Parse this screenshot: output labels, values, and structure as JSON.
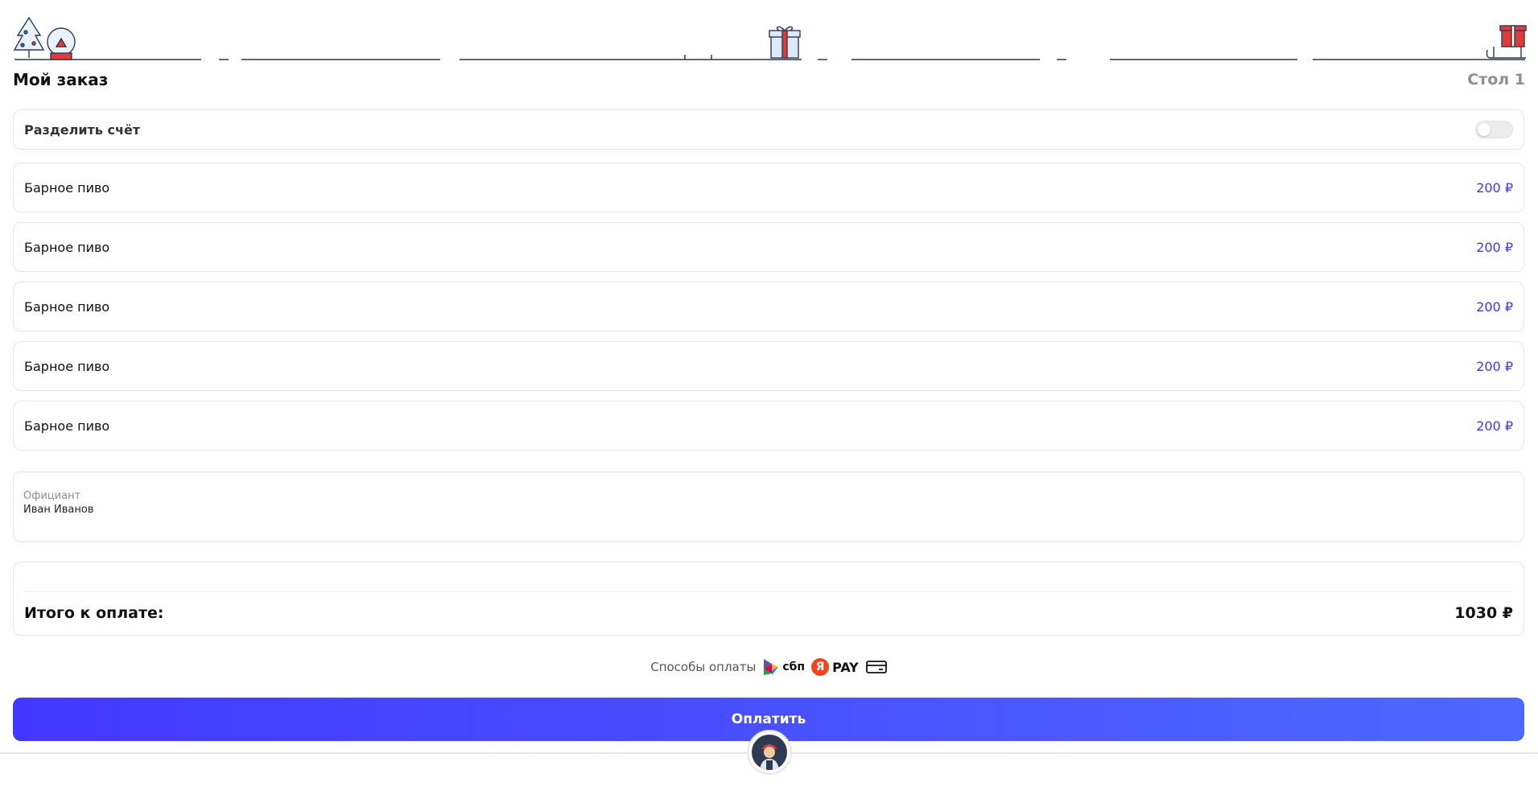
{
  "header": {
    "title": "Мой заказ",
    "table": "Стол 1"
  },
  "split": {
    "label": "Разделить счёт",
    "enabled": false
  },
  "items": [
    {
      "name": "Барное пиво",
      "price": "200 ₽"
    },
    {
      "name": "Барное пиво",
      "price": "200 ₽"
    },
    {
      "name": "Барное пиво",
      "price": "200 ₽"
    },
    {
      "name": "Барное пиво",
      "price": "200 ₽"
    },
    {
      "name": "Барное пиво",
      "price": "200 ₽"
    }
  ],
  "waiter": {
    "label": "Официант",
    "name": "Иван Иванов"
  },
  "total": {
    "label": "Итого к оплате:",
    "value": "1030 ₽"
  },
  "payment": {
    "label": "Способы оплаты",
    "sbp_text": "сбп",
    "ypay_letter": "Я",
    "ypay_text": "PAY"
  },
  "pay_button": {
    "label": "Оплатить"
  },
  "colors": {
    "accent": "#4338ff",
    "price": "#3b3bf0",
    "muted": "#8e8e93"
  }
}
